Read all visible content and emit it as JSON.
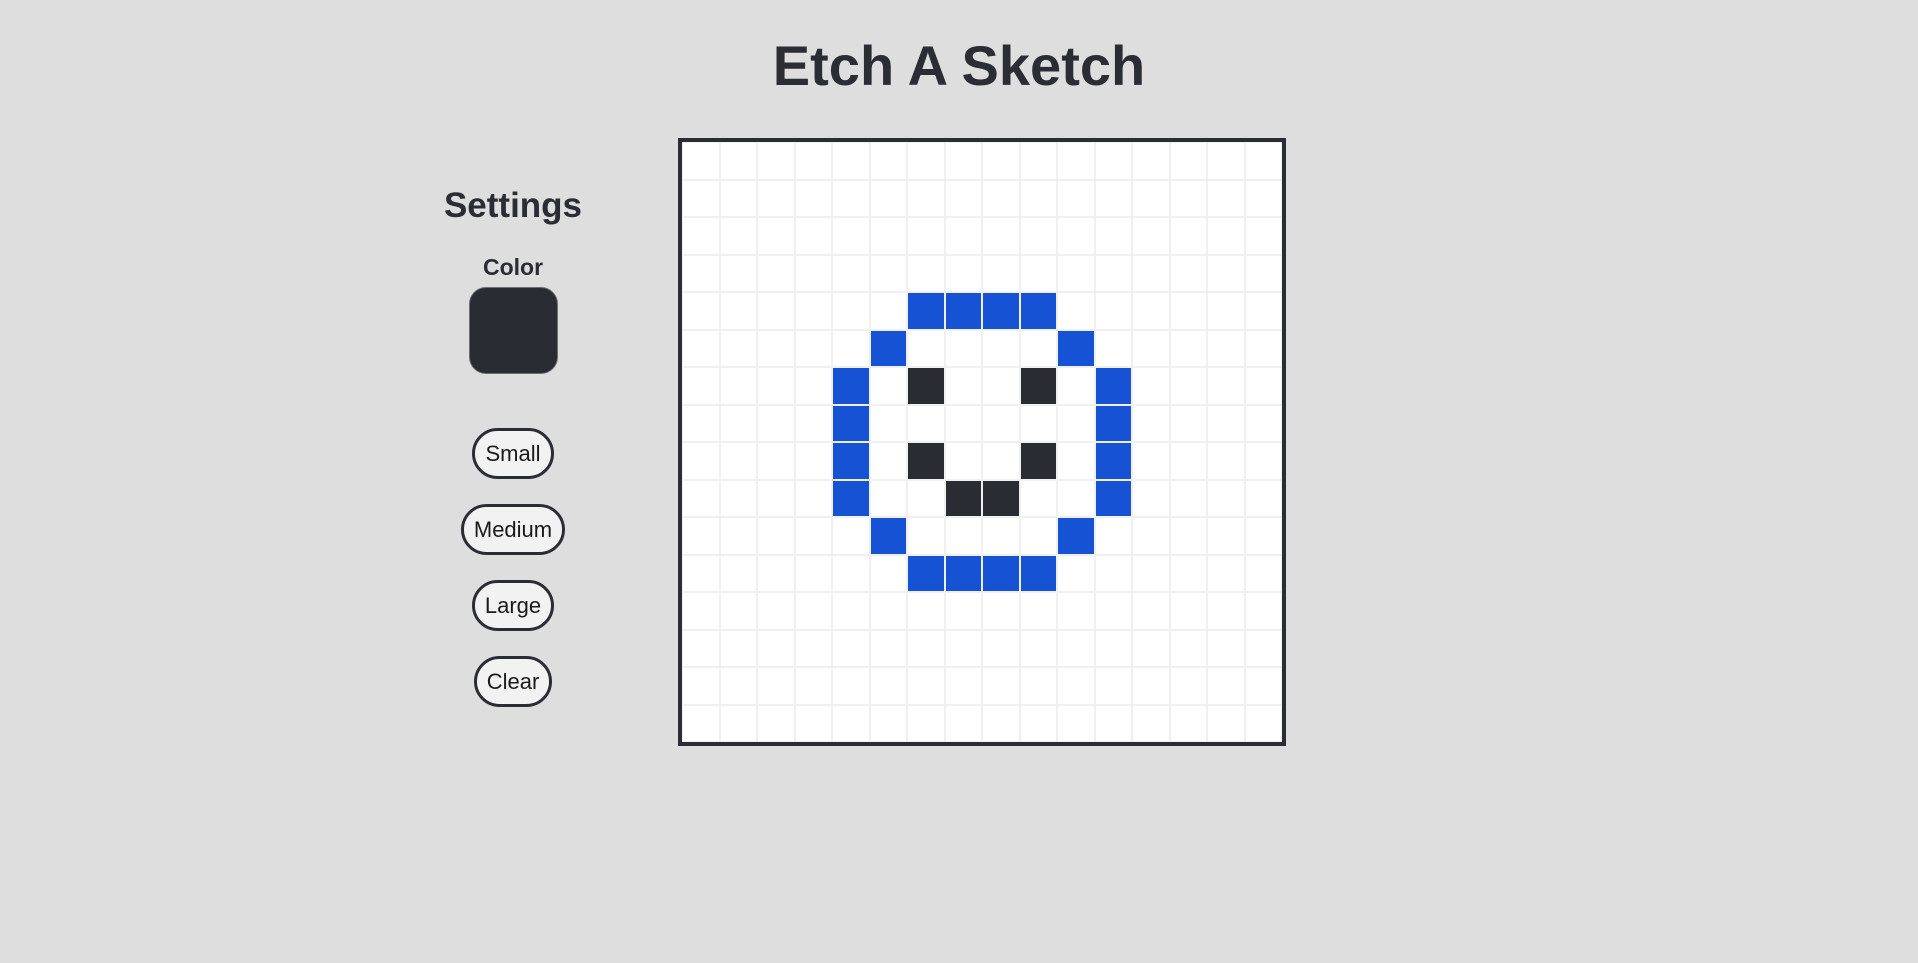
{
  "title": "Etch A Sketch",
  "settings": {
    "heading": "Settings",
    "color_label": "Color",
    "current_color": "#292c33",
    "buttons": {
      "small": "Small",
      "medium": "Medium",
      "large": "Large",
      "clear": "Clear"
    }
  },
  "board": {
    "grid_size": 16,
    "background_color": "#ffffff",
    "cell_border_color": "#f0f0f0",
    "palette": {
      "blue": "#1553d4",
      "dark": "#292c33"
    },
    "painted_cells": [
      {
        "row": 4,
        "col": 6,
        "color": "blue"
      },
      {
        "row": 4,
        "col": 7,
        "color": "blue"
      },
      {
        "row": 4,
        "col": 8,
        "color": "blue"
      },
      {
        "row": 4,
        "col": 9,
        "color": "blue"
      },
      {
        "row": 5,
        "col": 5,
        "color": "blue"
      },
      {
        "row": 5,
        "col": 10,
        "color": "blue"
      },
      {
        "row": 6,
        "col": 4,
        "color": "blue"
      },
      {
        "row": 6,
        "col": 6,
        "color": "dark"
      },
      {
        "row": 6,
        "col": 9,
        "color": "dark"
      },
      {
        "row": 6,
        "col": 11,
        "color": "blue"
      },
      {
        "row": 7,
        "col": 4,
        "color": "blue"
      },
      {
        "row": 7,
        "col": 11,
        "color": "blue"
      },
      {
        "row": 8,
        "col": 4,
        "color": "blue"
      },
      {
        "row": 8,
        "col": 6,
        "color": "dark"
      },
      {
        "row": 8,
        "col": 9,
        "color": "dark"
      },
      {
        "row": 8,
        "col": 11,
        "color": "blue"
      },
      {
        "row": 9,
        "col": 4,
        "color": "blue"
      },
      {
        "row": 9,
        "col": 7,
        "color": "dark"
      },
      {
        "row": 9,
        "col": 8,
        "color": "dark"
      },
      {
        "row": 9,
        "col": 11,
        "color": "blue"
      },
      {
        "row": 10,
        "col": 5,
        "color": "blue"
      },
      {
        "row": 10,
        "col": 10,
        "color": "blue"
      },
      {
        "row": 11,
        "col": 6,
        "color": "blue"
      },
      {
        "row": 11,
        "col": 7,
        "color": "blue"
      },
      {
        "row": 11,
        "col": 8,
        "color": "blue"
      },
      {
        "row": 11,
        "col": 9,
        "color": "blue"
      }
    ]
  }
}
